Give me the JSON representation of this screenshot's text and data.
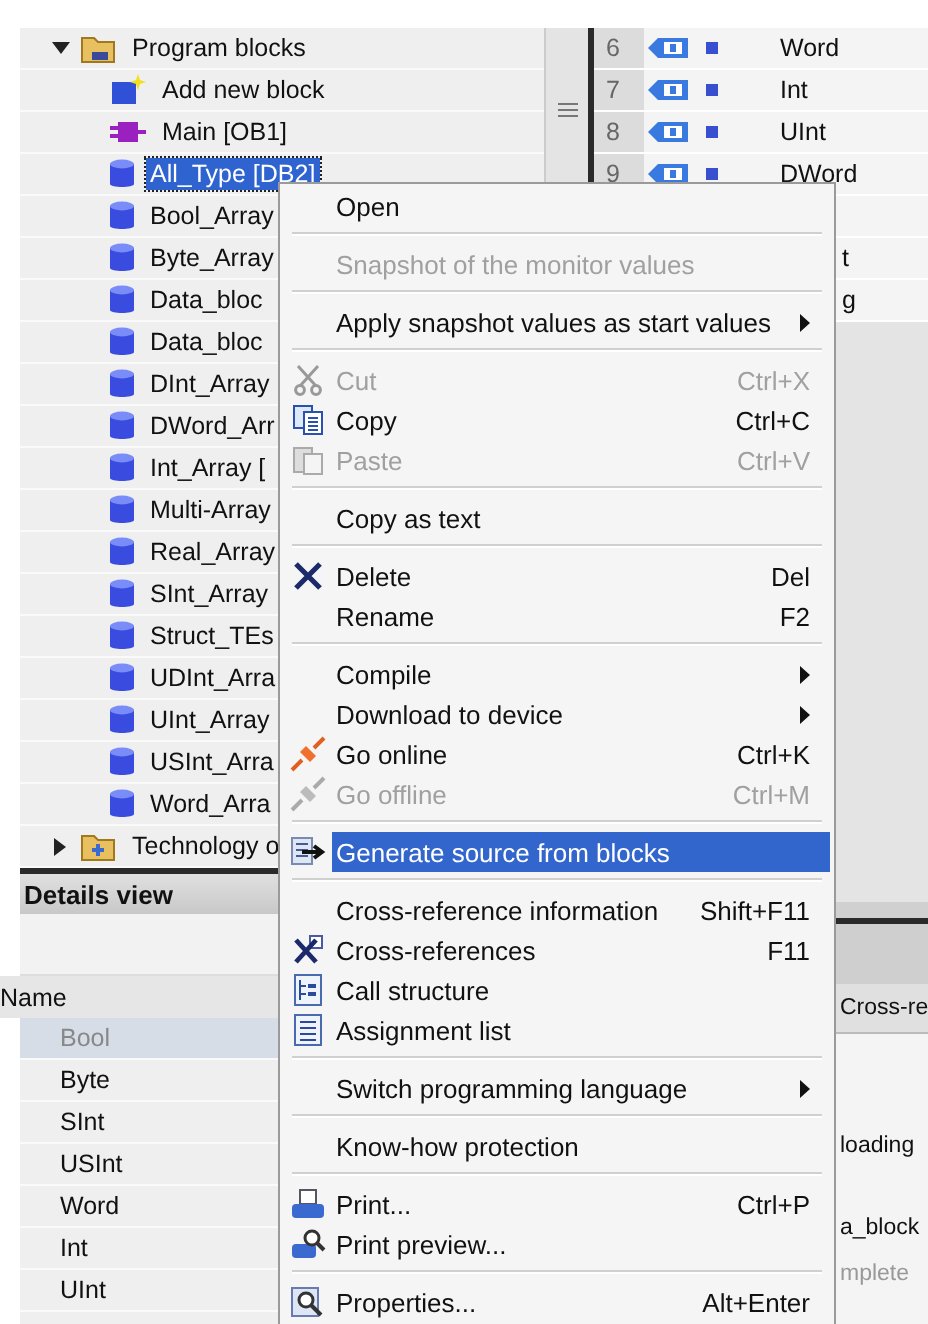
{
  "project_tree": {
    "items": [
      {
        "label": "Program blocks",
        "kind": "folder",
        "expanded": true,
        "children": [
          {
            "label": "Add new block",
            "kind": "add",
            "selected": false
          },
          {
            "label": "Main [OB1]",
            "kind": "ob",
            "selected": false
          },
          {
            "label": "All_Type [DB2]",
            "kind": "db",
            "selected": true
          },
          {
            "label": "Bool_Array",
            "kind": "db",
            "selected": false
          },
          {
            "label": "Byte_Array",
            "kind": "db",
            "selected": false
          },
          {
            "label": "Data_bloc",
            "kind": "db",
            "selected": false
          },
          {
            "label": "Data_bloc",
            "kind": "db",
            "selected": false
          },
          {
            "label": "DInt_Array",
            "kind": "db",
            "selected": false
          },
          {
            "label": "DWord_Arr",
            "kind": "db",
            "selected": false
          },
          {
            "label": "Int_Array [",
            "kind": "db",
            "selected": false
          },
          {
            "label": "Multi-Array",
            "kind": "db",
            "selected": false
          },
          {
            "label": "Real_Array",
            "kind": "db",
            "selected": false
          },
          {
            "label": "SInt_Array",
            "kind": "db",
            "selected": false
          },
          {
            "label": "Struct_TEs",
            "kind": "db",
            "selected": false
          },
          {
            "label": "UDInt_Arra",
            "kind": "db",
            "selected": false
          },
          {
            "label": "UInt_Array",
            "kind": "db",
            "selected": false
          },
          {
            "label": "USInt_Arra",
            "kind": "db",
            "selected": false
          },
          {
            "label": "Word_Arra",
            "kind": "db",
            "selected": false
          }
        ]
      },
      {
        "label": "Technology o",
        "kind": "techfolder",
        "expanded": false
      }
    ]
  },
  "details_view": {
    "title": "Details view",
    "column": "Name",
    "rows": [
      {
        "name": "Bool",
        "selected": true
      },
      {
        "name": "Byte",
        "selected": false
      },
      {
        "name": "SInt",
        "selected": false
      },
      {
        "name": "USInt",
        "selected": false
      },
      {
        "name": "Word",
        "selected": false
      },
      {
        "name": "Int",
        "selected": false
      },
      {
        "name": "UInt",
        "selected": false
      }
    ]
  },
  "block_table": {
    "rows": [
      {
        "number": "6",
        "type": "Word"
      },
      {
        "number": "7",
        "type": "Int"
      },
      {
        "number": "8",
        "type": "UInt"
      },
      {
        "number": "9",
        "type": "DWord"
      }
    ],
    "partial_cells": [
      "t",
      "g"
    ]
  },
  "lower_pane": {
    "tab": "Cross-re",
    "lines": [
      {
        "text": "loading",
        "disabled": false
      },
      {
        "text": "a_block",
        "disabled": false
      },
      {
        "text": "mplete",
        "disabled": true
      }
    ]
  },
  "context_menu": {
    "groups": [
      [
        {
          "label": "Open",
          "kind": "plain",
          "disabled": false,
          "submenu": false,
          "selected": false
        }
      ],
      [
        {
          "label": "Snapshot of the monitor values",
          "kind": "plain",
          "disabled": true,
          "submenu": false,
          "selected": false
        }
      ],
      [
        {
          "label": "Apply snapshot values as start values",
          "kind": "plain",
          "disabled": false,
          "submenu": true,
          "selected": false
        }
      ],
      [
        {
          "label": "Cut",
          "shortcut": "Ctrl+X",
          "kind": "scissors",
          "disabled": true,
          "submenu": false,
          "selected": false
        },
        {
          "label": "Copy",
          "shortcut": "Ctrl+C",
          "kind": "copy",
          "disabled": false,
          "submenu": false,
          "selected": false
        },
        {
          "label": "Paste",
          "shortcut": "Ctrl+V",
          "kind": "paste",
          "disabled": true,
          "submenu": false,
          "selected": false
        }
      ],
      [
        {
          "label": "Copy as text",
          "kind": "plain",
          "disabled": false,
          "submenu": false,
          "selected": false
        }
      ],
      [
        {
          "label": "Delete",
          "shortcut": "Del",
          "kind": "delete",
          "disabled": false,
          "submenu": false,
          "selected": false
        },
        {
          "label": "Rename",
          "shortcut": "F2",
          "kind": "plain",
          "disabled": false,
          "submenu": false,
          "selected": false
        }
      ],
      [
        {
          "label": "Compile",
          "kind": "plain",
          "disabled": false,
          "submenu": true,
          "selected": false
        },
        {
          "label": "Download to device",
          "kind": "plain",
          "disabled": false,
          "submenu": true,
          "selected": false
        },
        {
          "label": "Go online",
          "shortcut": "Ctrl+K",
          "kind": "plug",
          "disabled": false,
          "submenu": false,
          "selected": false
        },
        {
          "label": "Go offline",
          "shortcut": "Ctrl+M",
          "kind": "plug",
          "disabled": true,
          "submenu": false,
          "selected": false
        }
      ],
      [
        {
          "label": "Generate source from blocks",
          "kind": "generate",
          "disabled": false,
          "submenu": false,
          "selected": true
        }
      ],
      [
        {
          "label": "Cross-reference information",
          "shortcut": "Shift+F11",
          "kind": "plain",
          "disabled": false,
          "submenu": false,
          "selected": false
        },
        {
          "label": "Cross-references",
          "shortcut": "F11",
          "kind": "crossref",
          "disabled": false,
          "submenu": false,
          "selected": false
        },
        {
          "label": "Call structure",
          "kind": "tree",
          "disabled": false,
          "submenu": false,
          "selected": false
        },
        {
          "label": "Assignment list",
          "kind": "list",
          "disabled": false,
          "submenu": false,
          "selected": false
        }
      ],
      [
        {
          "label": "Switch programming language",
          "kind": "plain",
          "disabled": false,
          "submenu": true,
          "selected": false
        }
      ],
      [
        {
          "label": "Know-how protection",
          "kind": "plain",
          "disabled": false,
          "submenu": false,
          "selected": false
        }
      ],
      [
        {
          "label": "Print...",
          "shortcut": "Ctrl+P",
          "kind": "print",
          "disabled": false,
          "submenu": false,
          "selected": false
        },
        {
          "label": "Print preview...",
          "kind": "preview",
          "disabled": false,
          "submenu": false,
          "selected": false
        }
      ],
      [
        {
          "label": "Properties...",
          "shortcut": "Alt+Enter",
          "kind": "properties",
          "disabled": false,
          "submenu": false,
          "selected": false
        }
      ]
    ]
  }
}
